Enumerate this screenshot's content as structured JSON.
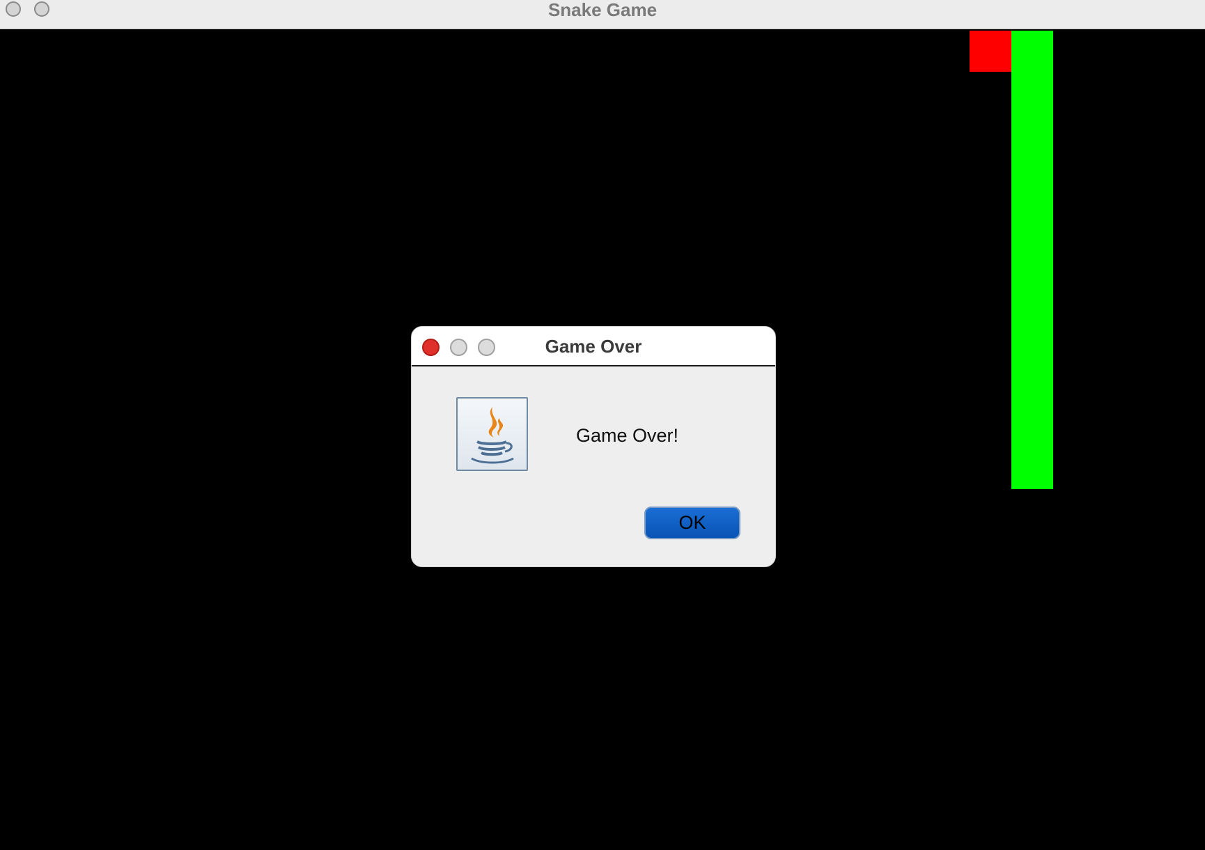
{
  "window": {
    "title": "Snake Game"
  },
  "game": {
    "background_color": "#000000",
    "snake_color": "#00ff00",
    "food_color": "#ff0000"
  },
  "dialog": {
    "title": "Game Over",
    "message": "Game Over!",
    "icon": "java-icon",
    "ok_label": "OK"
  }
}
